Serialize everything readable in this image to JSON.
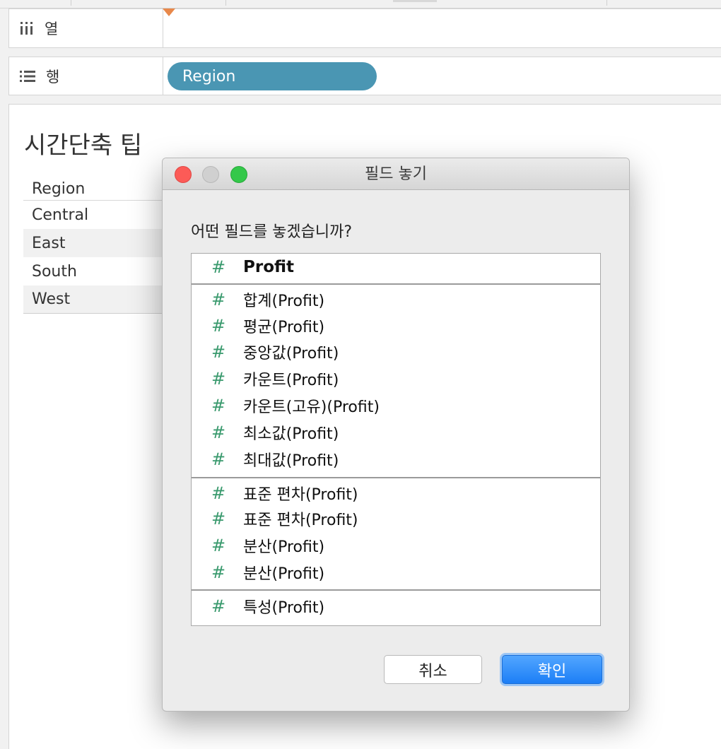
{
  "shelves": {
    "columns": {
      "label": "열",
      "icon": "columns-icon"
    },
    "rows": {
      "label": "행",
      "icon": "rows-list-icon",
      "pill": "Region"
    }
  },
  "sheet": {
    "title": "시간단축 팁",
    "table": {
      "header": "Region",
      "rows": [
        "Central",
        "East",
        "South",
        "West"
      ]
    }
  },
  "dialog": {
    "title": "필드 놓기",
    "question": "어떤 필드를 놓겠습니까?",
    "items": [
      "Profit",
      "합계(Profit)",
      "평균(Profit)",
      "중앙값(Profit)",
      "카운트(Profit)",
      "카운트(고유)(Profit)",
      "최소값(Profit)",
      "최대값(Profit)",
      "표준 편차(Profit)",
      "표준 편차(Profit)",
      "분산(Profit)",
      "분산(Profit)",
      "특성(Profit)"
    ],
    "item_icon": "measure-hash-icon",
    "cancel_label": "취소",
    "ok_label": "확인"
  },
  "colors": {
    "pill": "#4a96b3",
    "measure_icon": "#3a9a6e",
    "drop_marker": "#e8884a",
    "ok_button": "#1c7ef6"
  }
}
